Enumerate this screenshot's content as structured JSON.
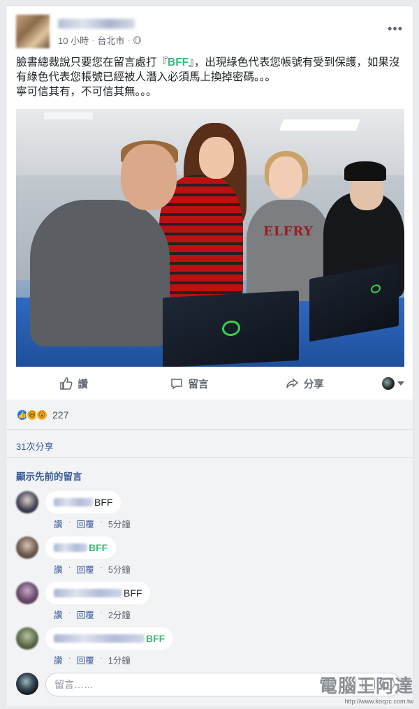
{
  "post": {
    "meta_time": "10 小時",
    "meta_sep": "·",
    "meta_location": "台北市",
    "text_part1": "臉書總裁說只要您在留言處打『",
    "text_green": "BFF",
    "text_part2": "』，出現綠色代表您帳號有受到保護，如果沒有綠色代表您帳號已經被人潛入必須馬上換掉密碼。。。",
    "text_line3": "寧可信其有，不可信其無。。。",
    "photo_shirt_text": "ELFRY",
    "more_icon": "more-icon"
  },
  "actions": {
    "like": "讚",
    "comment": "留言",
    "share": "分享"
  },
  "reactions": {
    "count": "227",
    "types": [
      "like",
      "haha",
      "wow"
    ]
  },
  "shares": "31次分享",
  "previous_comments": "顯示先前的留言",
  "comments": [
    {
      "text": "BFF",
      "green": false,
      "like": "讚",
      "reply": "回覆",
      "time": "5分鐘"
    },
    {
      "text": "BFF",
      "green": true,
      "like": "讚",
      "reply": "回覆",
      "time": "5分鐘"
    },
    {
      "text": "BFF",
      "green": false,
      "like": "讚",
      "reply": "回覆",
      "time": "2分鐘"
    },
    {
      "text": "BFF",
      "green": true,
      "like": "讚",
      "reply": "回覆",
      "time": "1分鐘"
    }
  ],
  "composer": {
    "placeholder": "留言……"
  },
  "watermark": {
    "title": "電腦王阿達",
    "url": "http://www.kocpc.com.tw"
  },
  "colors": {
    "green": "#3cb878",
    "link": "#385898",
    "like_blue": "#1877f2"
  }
}
